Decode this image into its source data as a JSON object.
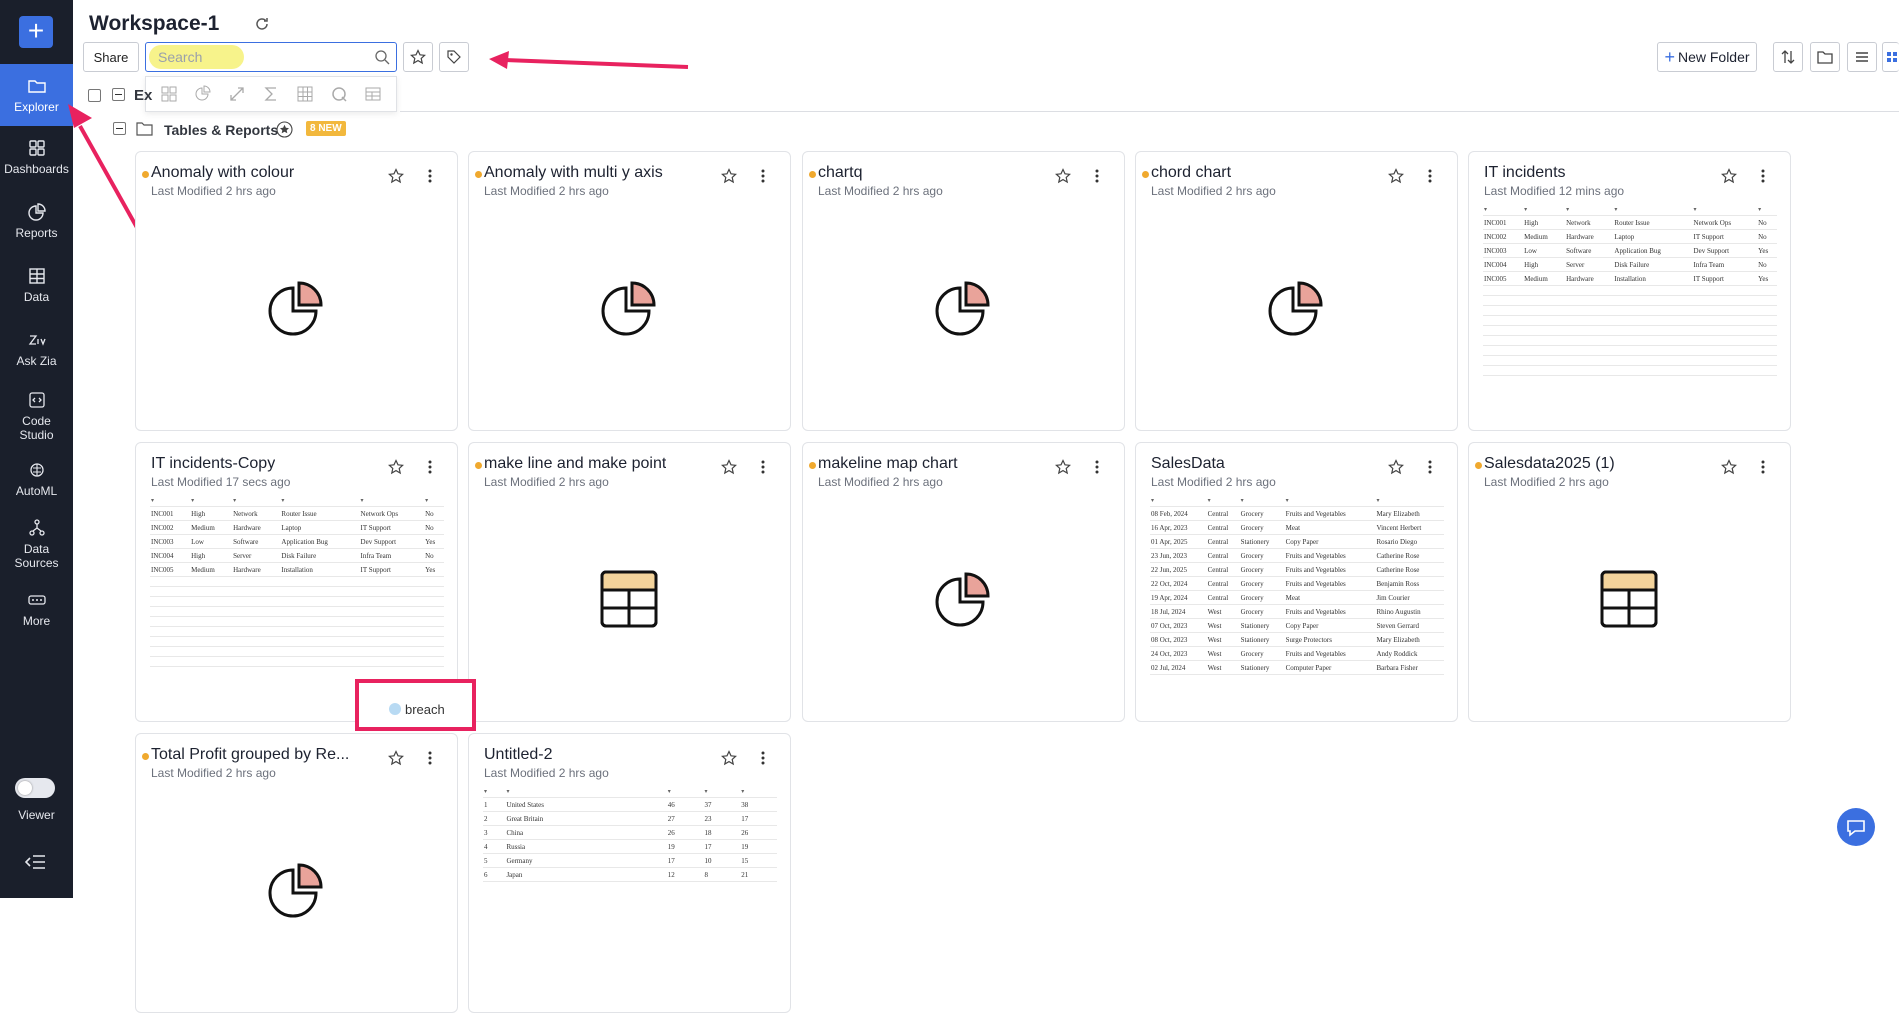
{
  "sidebar": {
    "add_label": "+",
    "items": [
      {
        "label": "Explorer",
        "icon": "folder-icon",
        "active": true
      },
      {
        "label": "Dashboards",
        "icon": "dashboard-icon"
      },
      {
        "label": "Reports",
        "icon": "pie-chart-icon"
      },
      {
        "label": "Data",
        "icon": "table-icon"
      },
      {
        "label": "Ask Zia",
        "icon": "zia-icon"
      },
      {
        "label": "Code Studio",
        "icon": "code-icon"
      },
      {
        "label": "AutoML",
        "icon": "brain-icon"
      },
      {
        "label": "Data Sources",
        "icon": "datasource-icon"
      },
      {
        "label": "More",
        "icon": "more-icon"
      }
    ],
    "viewer_label": "Viewer"
  },
  "header": {
    "title": "Workspace-1",
    "share_label": "Share",
    "search_placeholder": "Search",
    "new_folder_label": "New Folder"
  },
  "folder": {
    "name": "Tables & Reports",
    "badge": "8 NEW",
    "ex_label": "Ex"
  },
  "cards": [
    {
      "title": "Anomaly with colour",
      "modified": "Last Modified 2 hrs ago",
      "dot": true,
      "kind": "pie"
    },
    {
      "title": "Anomaly with multi y axis",
      "modified": "Last Modified 2 hrs ago",
      "dot": true,
      "kind": "pie"
    },
    {
      "title": "chartq",
      "modified": "Last Modified 2 hrs ago",
      "dot": true,
      "kind": "pie"
    },
    {
      "title": "chord chart",
      "modified": "Last Modified 2 hrs ago",
      "dot": true,
      "kind": "pie"
    },
    {
      "title": "IT incidents",
      "modified": "Last Modified 12 mins ago",
      "dot": false,
      "kind": "preview"
    },
    {
      "title": "IT incidents-Copy",
      "modified": "Last Modified 17 secs ago",
      "dot": false,
      "kind": "preview"
    },
    {
      "title": "make line and make point",
      "modified": "Last Modified 2 hrs ago",
      "dot": true,
      "kind": "table"
    },
    {
      "title": "makeline map chart",
      "modified": "Last Modified 2 hrs ago",
      "dot": true,
      "kind": "pie"
    },
    {
      "title": "SalesData",
      "modified": "Last Modified 2 hrs ago",
      "dot": false,
      "kind": "sales"
    },
    {
      "title": "Salesdata2025 (1)",
      "modified": "Last Modified 2 hrs ago",
      "dot": true,
      "kind": "table"
    },
    {
      "title": "Total Profit grouped by Re...",
      "modified": "Last Modified 2 hrs ago",
      "dot": true,
      "kind": "pie"
    },
    {
      "title": "Untitled-2",
      "modified": "Last Modified 2 hrs ago",
      "dot": false,
      "kind": "countries"
    }
  ],
  "incidents_rows": [
    [
      "INC001",
      "High",
      "Network",
      "Router Issue",
      "Network Ops",
      "No"
    ],
    [
      "INC002",
      "Medium",
      "Hardware",
      "Laptop",
      "IT Support",
      "No"
    ],
    [
      "INC003",
      "Low",
      "Software",
      "Application Bug",
      "Dev Support",
      "Yes"
    ],
    [
      "INC004",
      "High",
      "Server",
      "Disk Failure",
      "Infra Team",
      "No"
    ],
    [
      "INC005",
      "Medium",
      "Hardware",
      "Installation",
      "IT Support",
      "Yes"
    ]
  ],
  "sales_rows": [
    [
      "08 Feb, 2024",
      "Central",
      "Grocery",
      "Fruits and Vegetables",
      "Mary Elizabeth"
    ],
    [
      "16 Apr, 2023",
      "Central",
      "Grocery",
      "Meat",
      "Vincent Herbert"
    ],
    [
      "01 Apr, 2025",
      "Central",
      "Stationery",
      "Copy Paper",
      "Rosario Diego"
    ],
    [
      "23 Jun, 2023",
      "Central",
      "Grocery",
      "Fruits and Vegetables",
      "Catherine Rose"
    ],
    [
      "22 Jun, 2025",
      "Central",
      "Grocery",
      "Fruits and Vegetables",
      "Catherine Rose"
    ],
    [
      "22 Oct, 2024",
      "Central",
      "Grocery",
      "Fruits and Vegetables",
      "Benjamin Ross"
    ],
    [
      "19 Apr, 2024",
      "Central",
      "Grocery",
      "Meat",
      "Jim Courier"
    ],
    [
      "18 Jul, 2024",
      "West",
      "Grocery",
      "Fruits and Vegetables",
      "Rhino Augustin"
    ],
    [
      "07 Oct, 2023",
      "West",
      "Stationery",
      "Copy Paper",
      "Steven Gerrard"
    ],
    [
      "08 Oct, 2023",
      "West",
      "Stationery",
      "Surge Protectors",
      "Mary Elizabeth"
    ],
    [
      "24 Oct, 2023",
      "West",
      "Grocery",
      "Fruits and Vegetables",
      "Andy Roddick"
    ],
    [
      "02 Jul, 2024",
      "West",
      "Stationery",
      "Computer Paper",
      "Barbara Fisher"
    ]
  ],
  "country_rows": [
    [
      "1",
      "United States",
      "46",
      "37",
      "38"
    ],
    [
      "2",
      "Great Britain",
      "27",
      "23",
      "17"
    ],
    [
      "3",
      "China",
      "26",
      "18",
      "26"
    ],
    [
      "4",
      "Russia",
      "19",
      "17",
      "19"
    ],
    [
      "5",
      "Germany",
      "17",
      "10",
      "15"
    ],
    [
      "6",
      "Japan",
      "12",
      "8",
      "21"
    ]
  ],
  "breach_label": "breach",
  "colors": {
    "accent": "#3b6fe0",
    "sidebar": "#1a1f2b",
    "new_dot": "#f0a92e",
    "annotation": "#e8225f"
  }
}
